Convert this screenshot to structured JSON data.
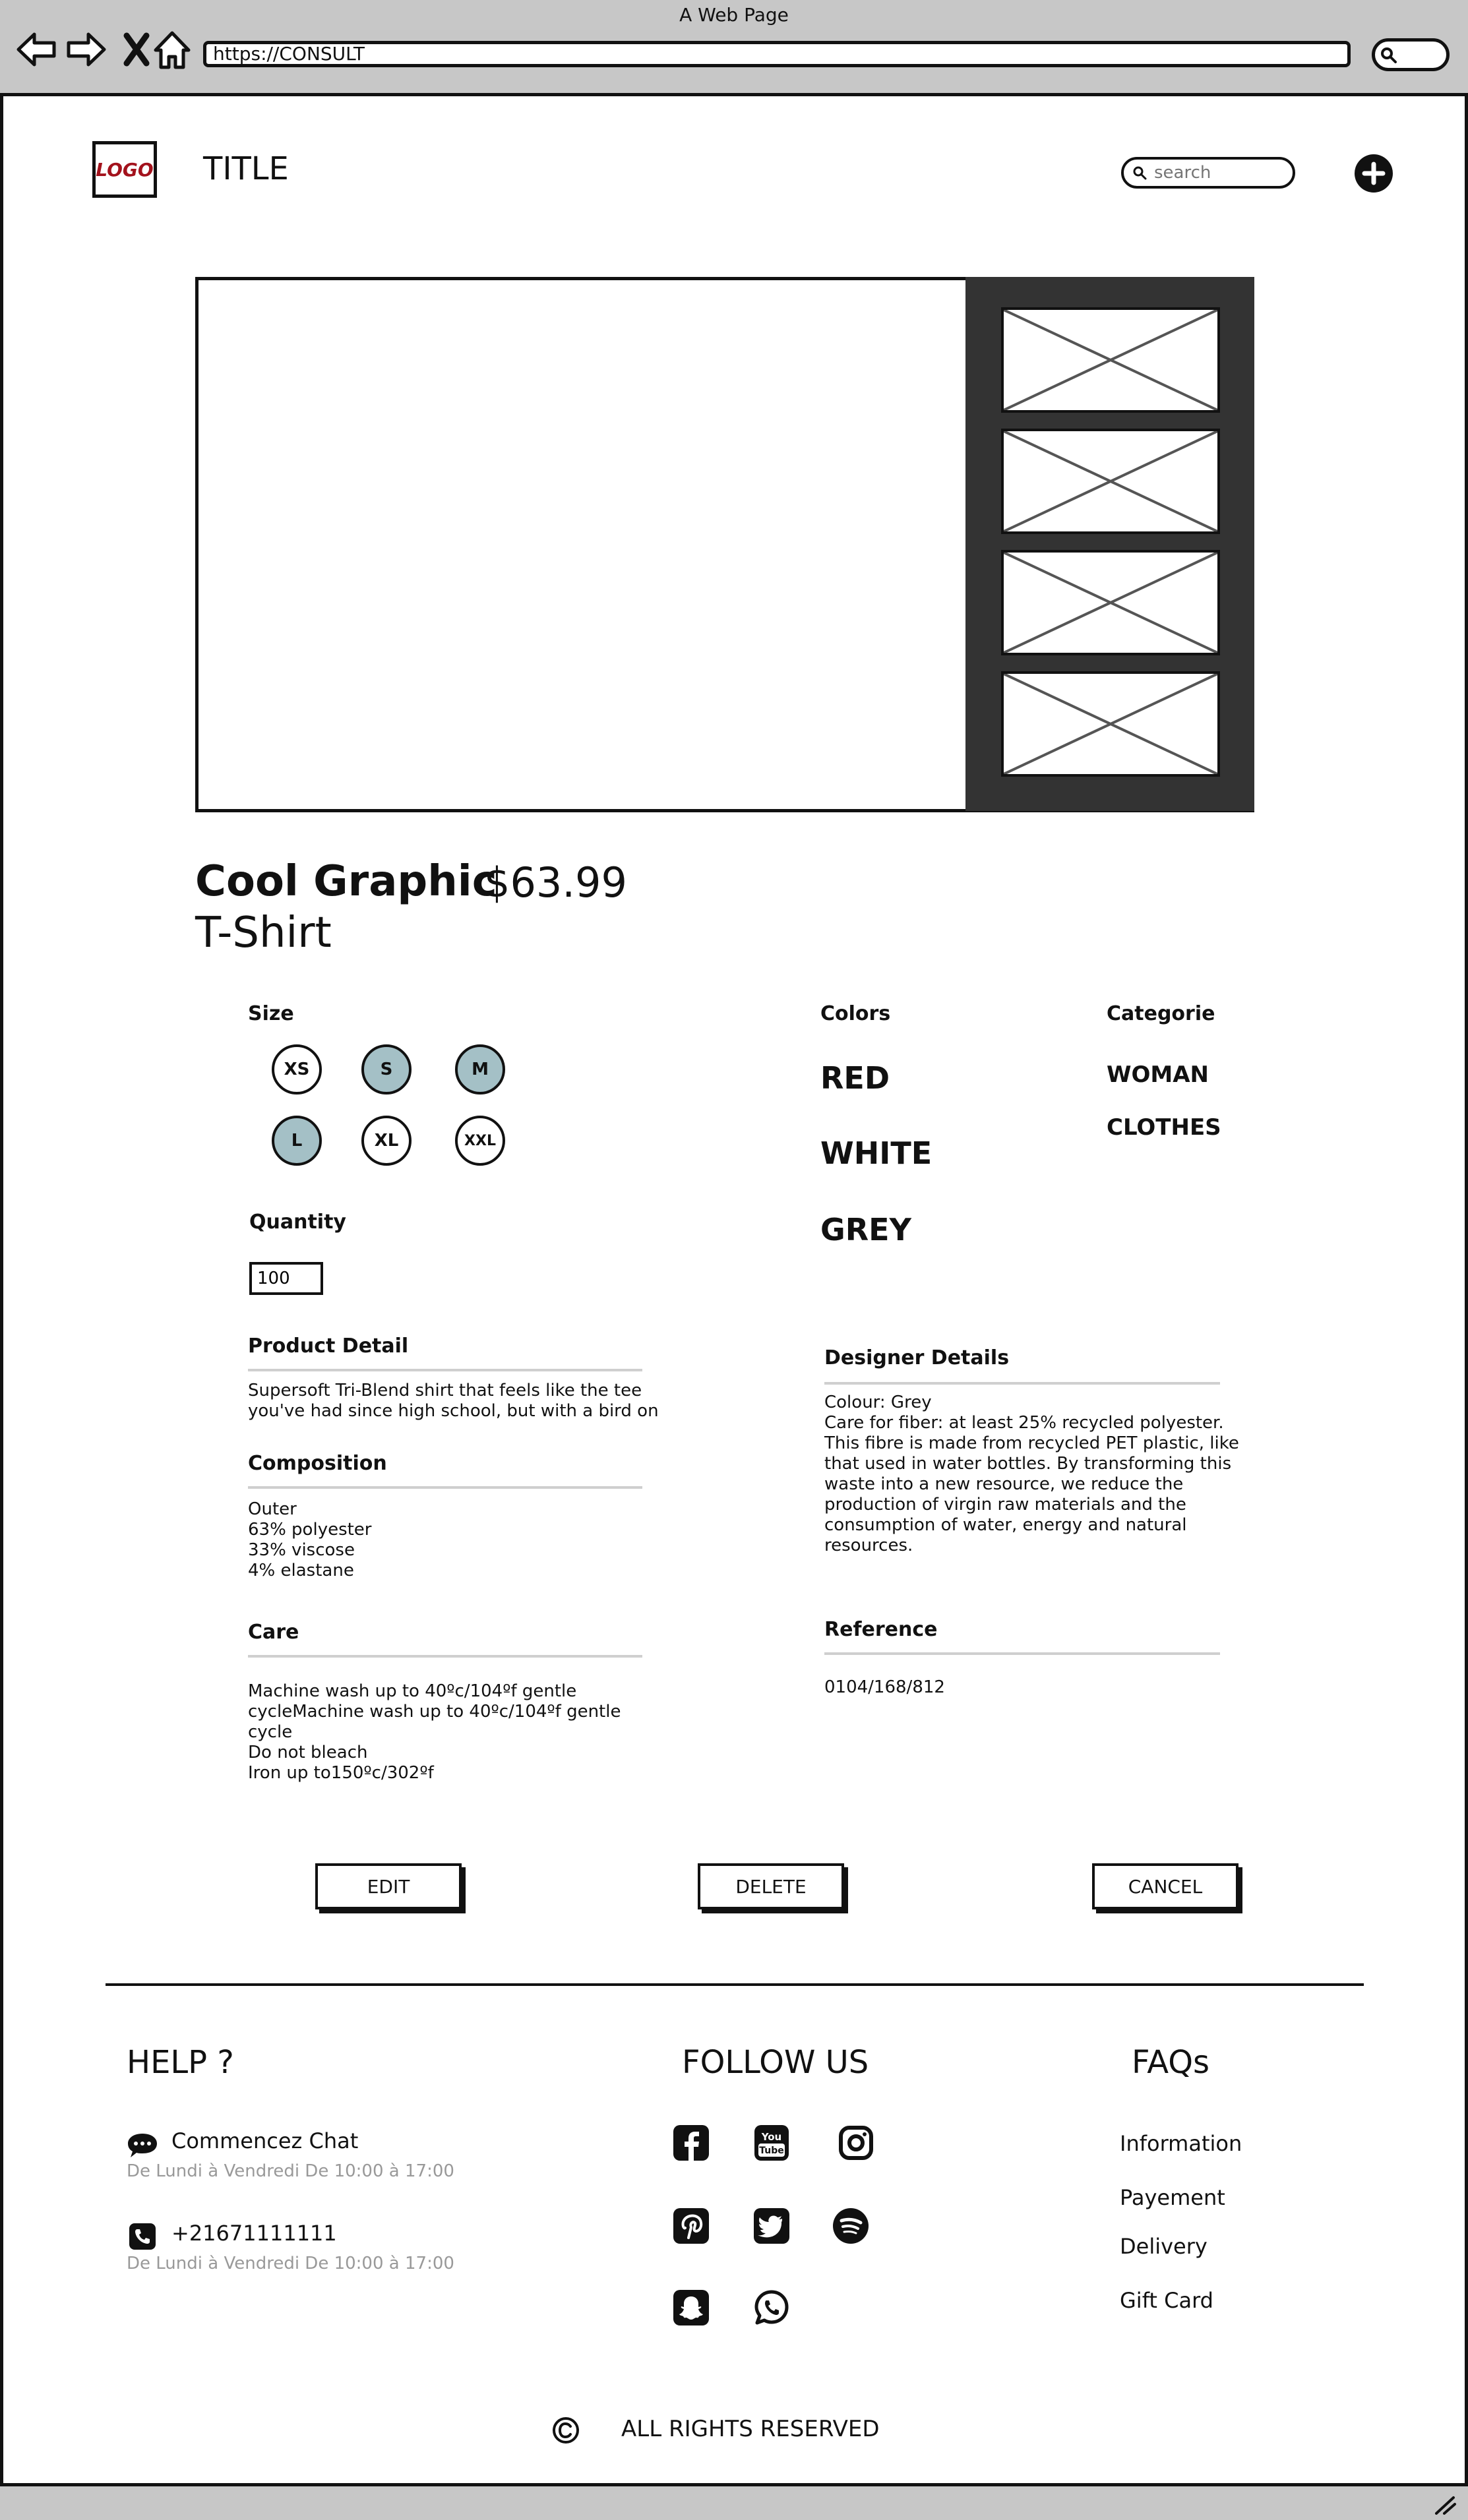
{
  "window": {
    "title": "A Web Page",
    "url": "https://CONSULT"
  },
  "header": {
    "logo": "LOGO",
    "title": "TITLE",
    "search_placeholder": "search"
  },
  "product": {
    "name_line1": "Cool Graphic",
    "name_line2": "T-Shirt",
    "price": "$63.99"
  },
  "size": {
    "label": "Size",
    "options": [
      {
        "label": "XS",
        "selected": false
      },
      {
        "label": "S",
        "selected": true
      },
      {
        "label": "M",
        "selected": true
      },
      {
        "label": "L",
        "selected": true
      },
      {
        "label": "XL",
        "selected": false
      },
      {
        "label": "XXL",
        "selected": false
      }
    ],
    "selected_color": "#a4c0c6"
  },
  "quantity": {
    "label": "Quantity",
    "value": "100"
  },
  "colors": {
    "label": "Colors",
    "items": [
      "RED",
      "WHITE",
      "GREY"
    ]
  },
  "categorie": {
    "label": "Categorie",
    "items": [
      "WOMAN",
      "CLOTHES"
    ]
  },
  "product_detail": {
    "title": "Product Detail",
    "text": "Supersoft Tri-Blend shirt that feels like the tee\nyou've had since high school, but with a bird on"
  },
  "composition": {
    "title": "Composition",
    "text": "Outer\n63% polyester\n33% viscose\n4% elastane"
  },
  "care": {
    "title": "Care",
    "text": "Machine wash up to 40ºc/104ºf gentle\ncycleMachine wash up to 40ºc/104ºf gentle\ncycle\nDo not bleach\nIron up to150ºc/302ºf"
  },
  "designer_details": {
    "title": "Designer Details",
    "text": "Colour: Grey\nCare for fiber: at least 25% recycled polyester.\nThis fibre is made from recycled PET plastic, like\nthat used in water bottles. By transforming this\nwaste into a new resource, we reduce the\nproduction of virgin raw materials and the\nconsumption of water, energy and natural\nresources."
  },
  "reference": {
    "title": "Reference",
    "value": "0104/168/812"
  },
  "actions": {
    "edit": "EDIT",
    "delete": "DELETE",
    "cancel": "CANCEL"
  },
  "footer": {
    "help": {
      "heading": "HELP ?",
      "chat_label": "Commencez Chat",
      "chat_hours": "De Lundi à Vendredi De 10:00 à 17:00",
      "phone": "+21671111111",
      "phone_hours": "De Lundi à Vendredi De 10:00 à 17:00"
    },
    "follow": {
      "heading": "FOLLOW US",
      "icons": [
        "facebook-icon",
        "youtube-icon",
        "instagram-icon",
        "pinterest-icon",
        "twitter-icon",
        "spotify-icon",
        "snapchat-icon",
        "whatsapp-icon"
      ]
    },
    "faqs": {
      "heading": "FAQs",
      "links": [
        "Information",
        "Payement",
        "Delivery",
        "Gift Card"
      ]
    },
    "rights": "ALL RIGHTS RESERVED"
  }
}
